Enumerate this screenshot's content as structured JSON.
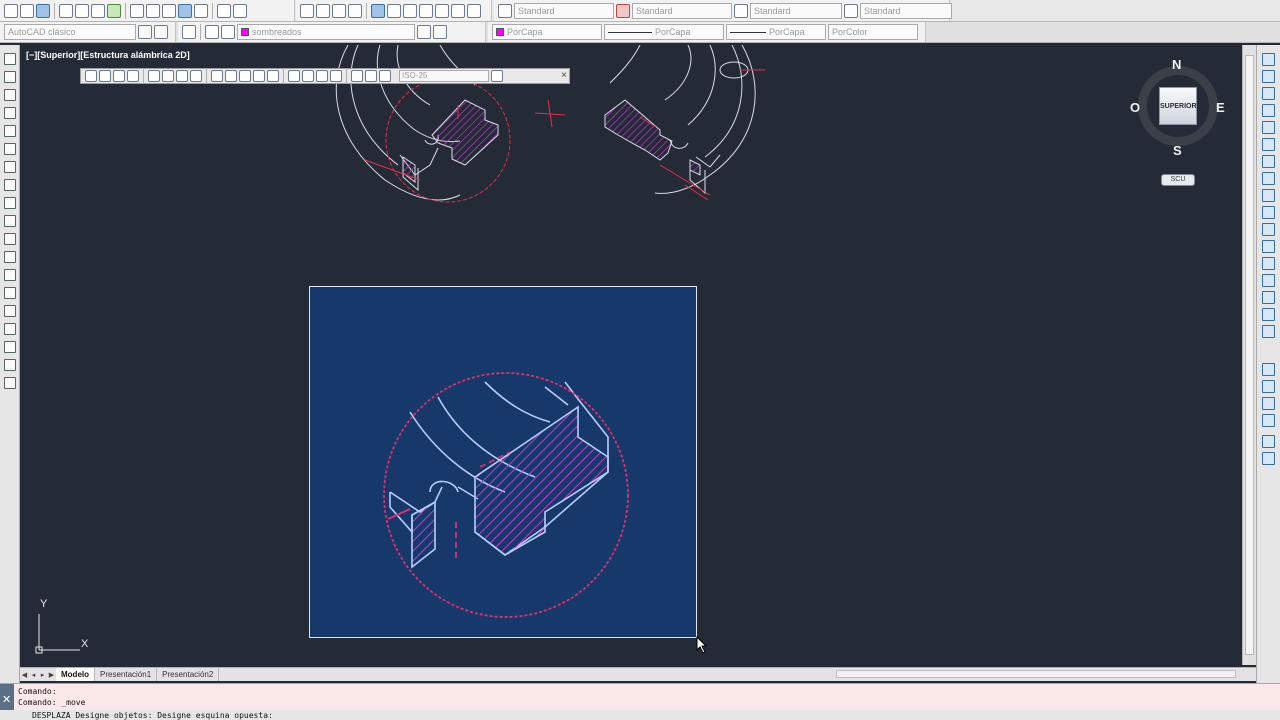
{
  "toolbar_top": {
    "workspace_combo": "",
    "text_style_combo": "Standard",
    "dim_style_combo": "Standard",
    "table_style_combo": "Standard",
    "multileader_style_combo": "Standard"
  },
  "toolbar_properties": {
    "workspace": "AutoCAD clásico",
    "layer": "sombreados",
    "color": "PorCapa",
    "linetype": "PorCapa",
    "lineweight": "PorCapa",
    "plotstyle": "PorColor",
    "layer_color": "#ff00ff"
  },
  "viewport": {
    "label": "[−][Superior][Estructura alámbrica 2D]"
  },
  "dim_toolbar": {
    "style_combo": "ISO-25"
  },
  "viewcube": {
    "face_label": "SUPERIOR",
    "north": "N",
    "south": "S",
    "east": "E",
    "west": "O",
    "ucs_label": "SCU"
  },
  "ucs_icon": {
    "x_label": "X",
    "y_label": "Y"
  },
  "tabs": {
    "model": "Modelo",
    "layout1": "Presentación1",
    "layout2": "Presentación2"
  },
  "command": {
    "line1": "Comando:",
    "line2": "Comando: _move",
    "line3": "DESPLAZA Designe objetos: Designe esquina opuesta:",
    "close_glyph": "✕"
  },
  "colors": {
    "background": "#252b36",
    "zoom_panel": "#16386a",
    "hatch": "#c43ad6",
    "construction": "#e0304a",
    "outline": "#d9dde6"
  }
}
